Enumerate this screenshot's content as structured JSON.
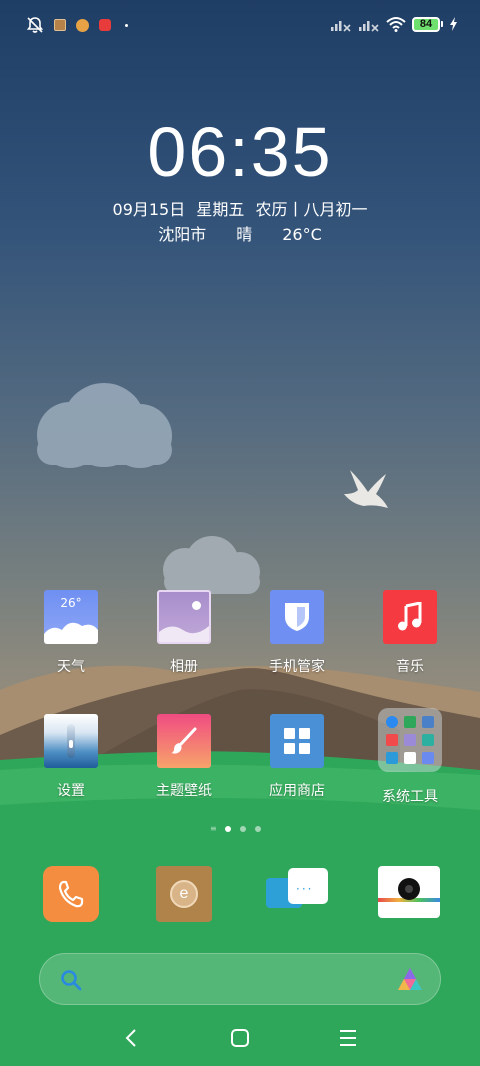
{
  "status_bar": {
    "left_icons": [
      "bell-muted-icon",
      "app-notification-icon",
      "orange-circle-icon",
      "red-app-icon",
      "more-dot-icon"
    ],
    "right_icons": [
      "signal-no-sim-1-icon",
      "signal-no-sim-2-icon",
      "wifi-icon"
    ],
    "battery_level": "84",
    "charging": true
  },
  "clock": {
    "time": "06:35",
    "date": "09月15日",
    "weekday": "星期五",
    "lunar": "农历丨八月初一",
    "city": "沈阳市",
    "weather": "晴",
    "temperature": "26°C"
  },
  "apps_row1": [
    {
      "label": "天气",
      "icon": "weather-icon",
      "temp_badge": "26°"
    },
    {
      "label": "相册",
      "icon": "gallery-icon"
    },
    {
      "label": "手机管家",
      "icon": "security-shield-icon"
    },
    {
      "label": "音乐",
      "icon": "music-icon"
    }
  ],
  "apps_row2": [
    {
      "label": "设置",
      "icon": "settings-icon"
    },
    {
      "label": "主题壁纸",
      "icon": "themes-brush-icon"
    },
    {
      "label": "应用商店",
      "icon": "app-store-icon"
    },
    {
      "label": "系统工具",
      "icon": "folder-icon"
    }
  ],
  "page_indicator": {
    "pages": 3,
    "current": 1
  },
  "dock": [
    {
      "icon": "phone-icon"
    },
    {
      "icon": "browser-icon"
    },
    {
      "icon": "messages-icon"
    },
    {
      "icon": "camera-icon"
    }
  ],
  "navbar": [
    "back-icon",
    "home-icon",
    "recents-icon"
  ],
  "colors": {
    "sky_top": "#1f3e66",
    "grass": "#2fa75a",
    "music_red": "#f53a42",
    "phone_orange": "#f58d40",
    "weather_blue": "#6f8ff2"
  }
}
